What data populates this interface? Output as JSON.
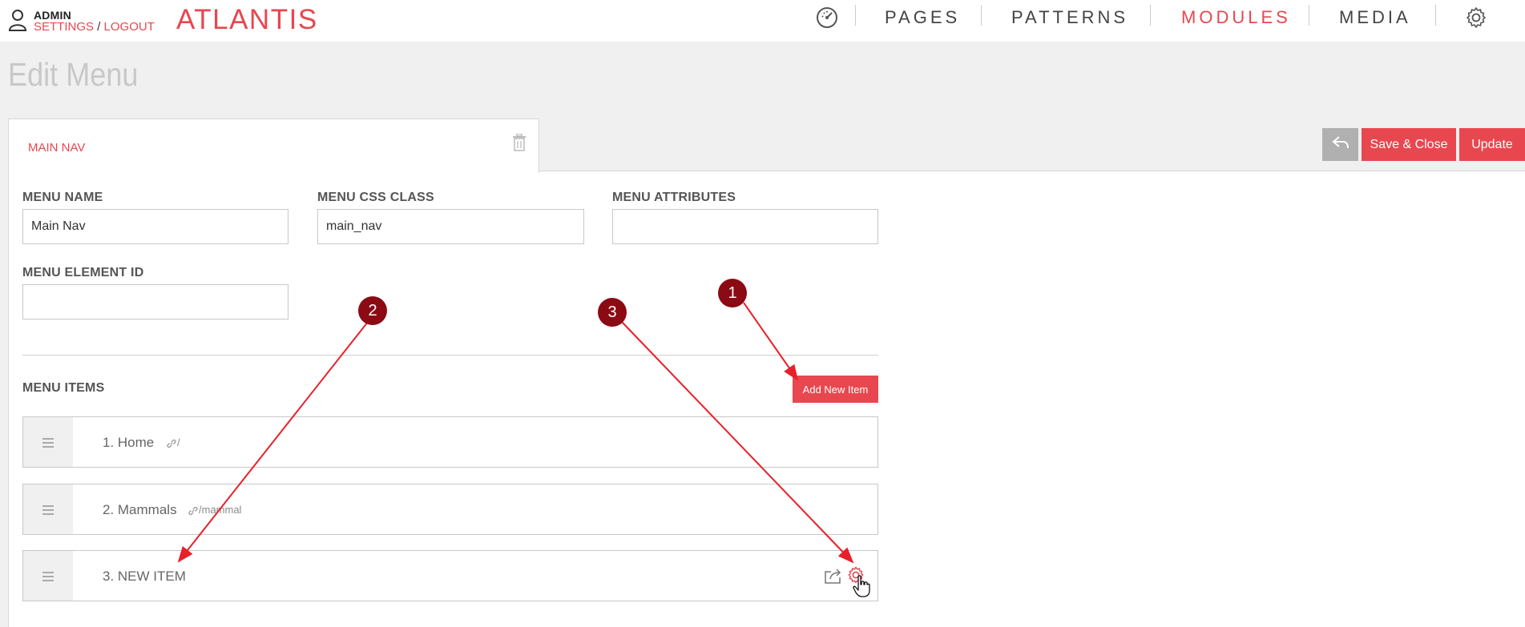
{
  "header": {
    "user_role": "ADMIN",
    "settings_link": "SETTINGS",
    "separator": "/",
    "logout_link": "LOGOUT",
    "brand": "ATLANTIS",
    "nav": [
      {
        "label": "PAGES",
        "active": false
      },
      {
        "label": "PATTERNS",
        "active": false
      },
      {
        "label": "MODULES",
        "active": true
      },
      {
        "label": "MEDIA",
        "active": false
      }
    ],
    "icons": [
      "dashboard-icon",
      "settings-gear-icon"
    ]
  },
  "page": {
    "title": "Edit Menu"
  },
  "tab": {
    "label": "MAIN NAV"
  },
  "toolbar": {
    "back_icon": "back-arrow-icon",
    "save_close_label": "Save & Close",
    "update_label": "Update"
  },
  "form": {
    "menu_name": {
      "label": "MENU NAME",
      "value": "Main Nav"
    },
    "menu_css_class": {
      "label": "MENU CSS CLASS",
      "value": "main_nav"
    },
    "menu_attributes": {
      "label": "MENU ATTRIBUTES",
      "value": ""
    },
    "menu_element_id": {
      "label": "MENU ELEMENT ID",
      "value": ""
    }
  },
  "menu_items": {
    "heading": "MENU ITEMS",
    "add_button": "Add New Item",
    "items": [
      {
        "label": "1. Home",
        "link": "/"
      },
      {
        "label": "2. Mammals",
        "link": "/mammal"
      },
      {
        "label": "3. NEW ITEM",
        "link": ""
      }
    ]
  },
  "annotations": {
    "badges": [
      "1",
      "2",
      "3"
    ],
    "color": "#8b0a14",
    "arrow_color": "#e8202a"
  },
  "colors": {
    "accent": "#e8474f",
    "neutral_button": "#b0b0b0",
    "background": "#f0f0f0"
  }
}
